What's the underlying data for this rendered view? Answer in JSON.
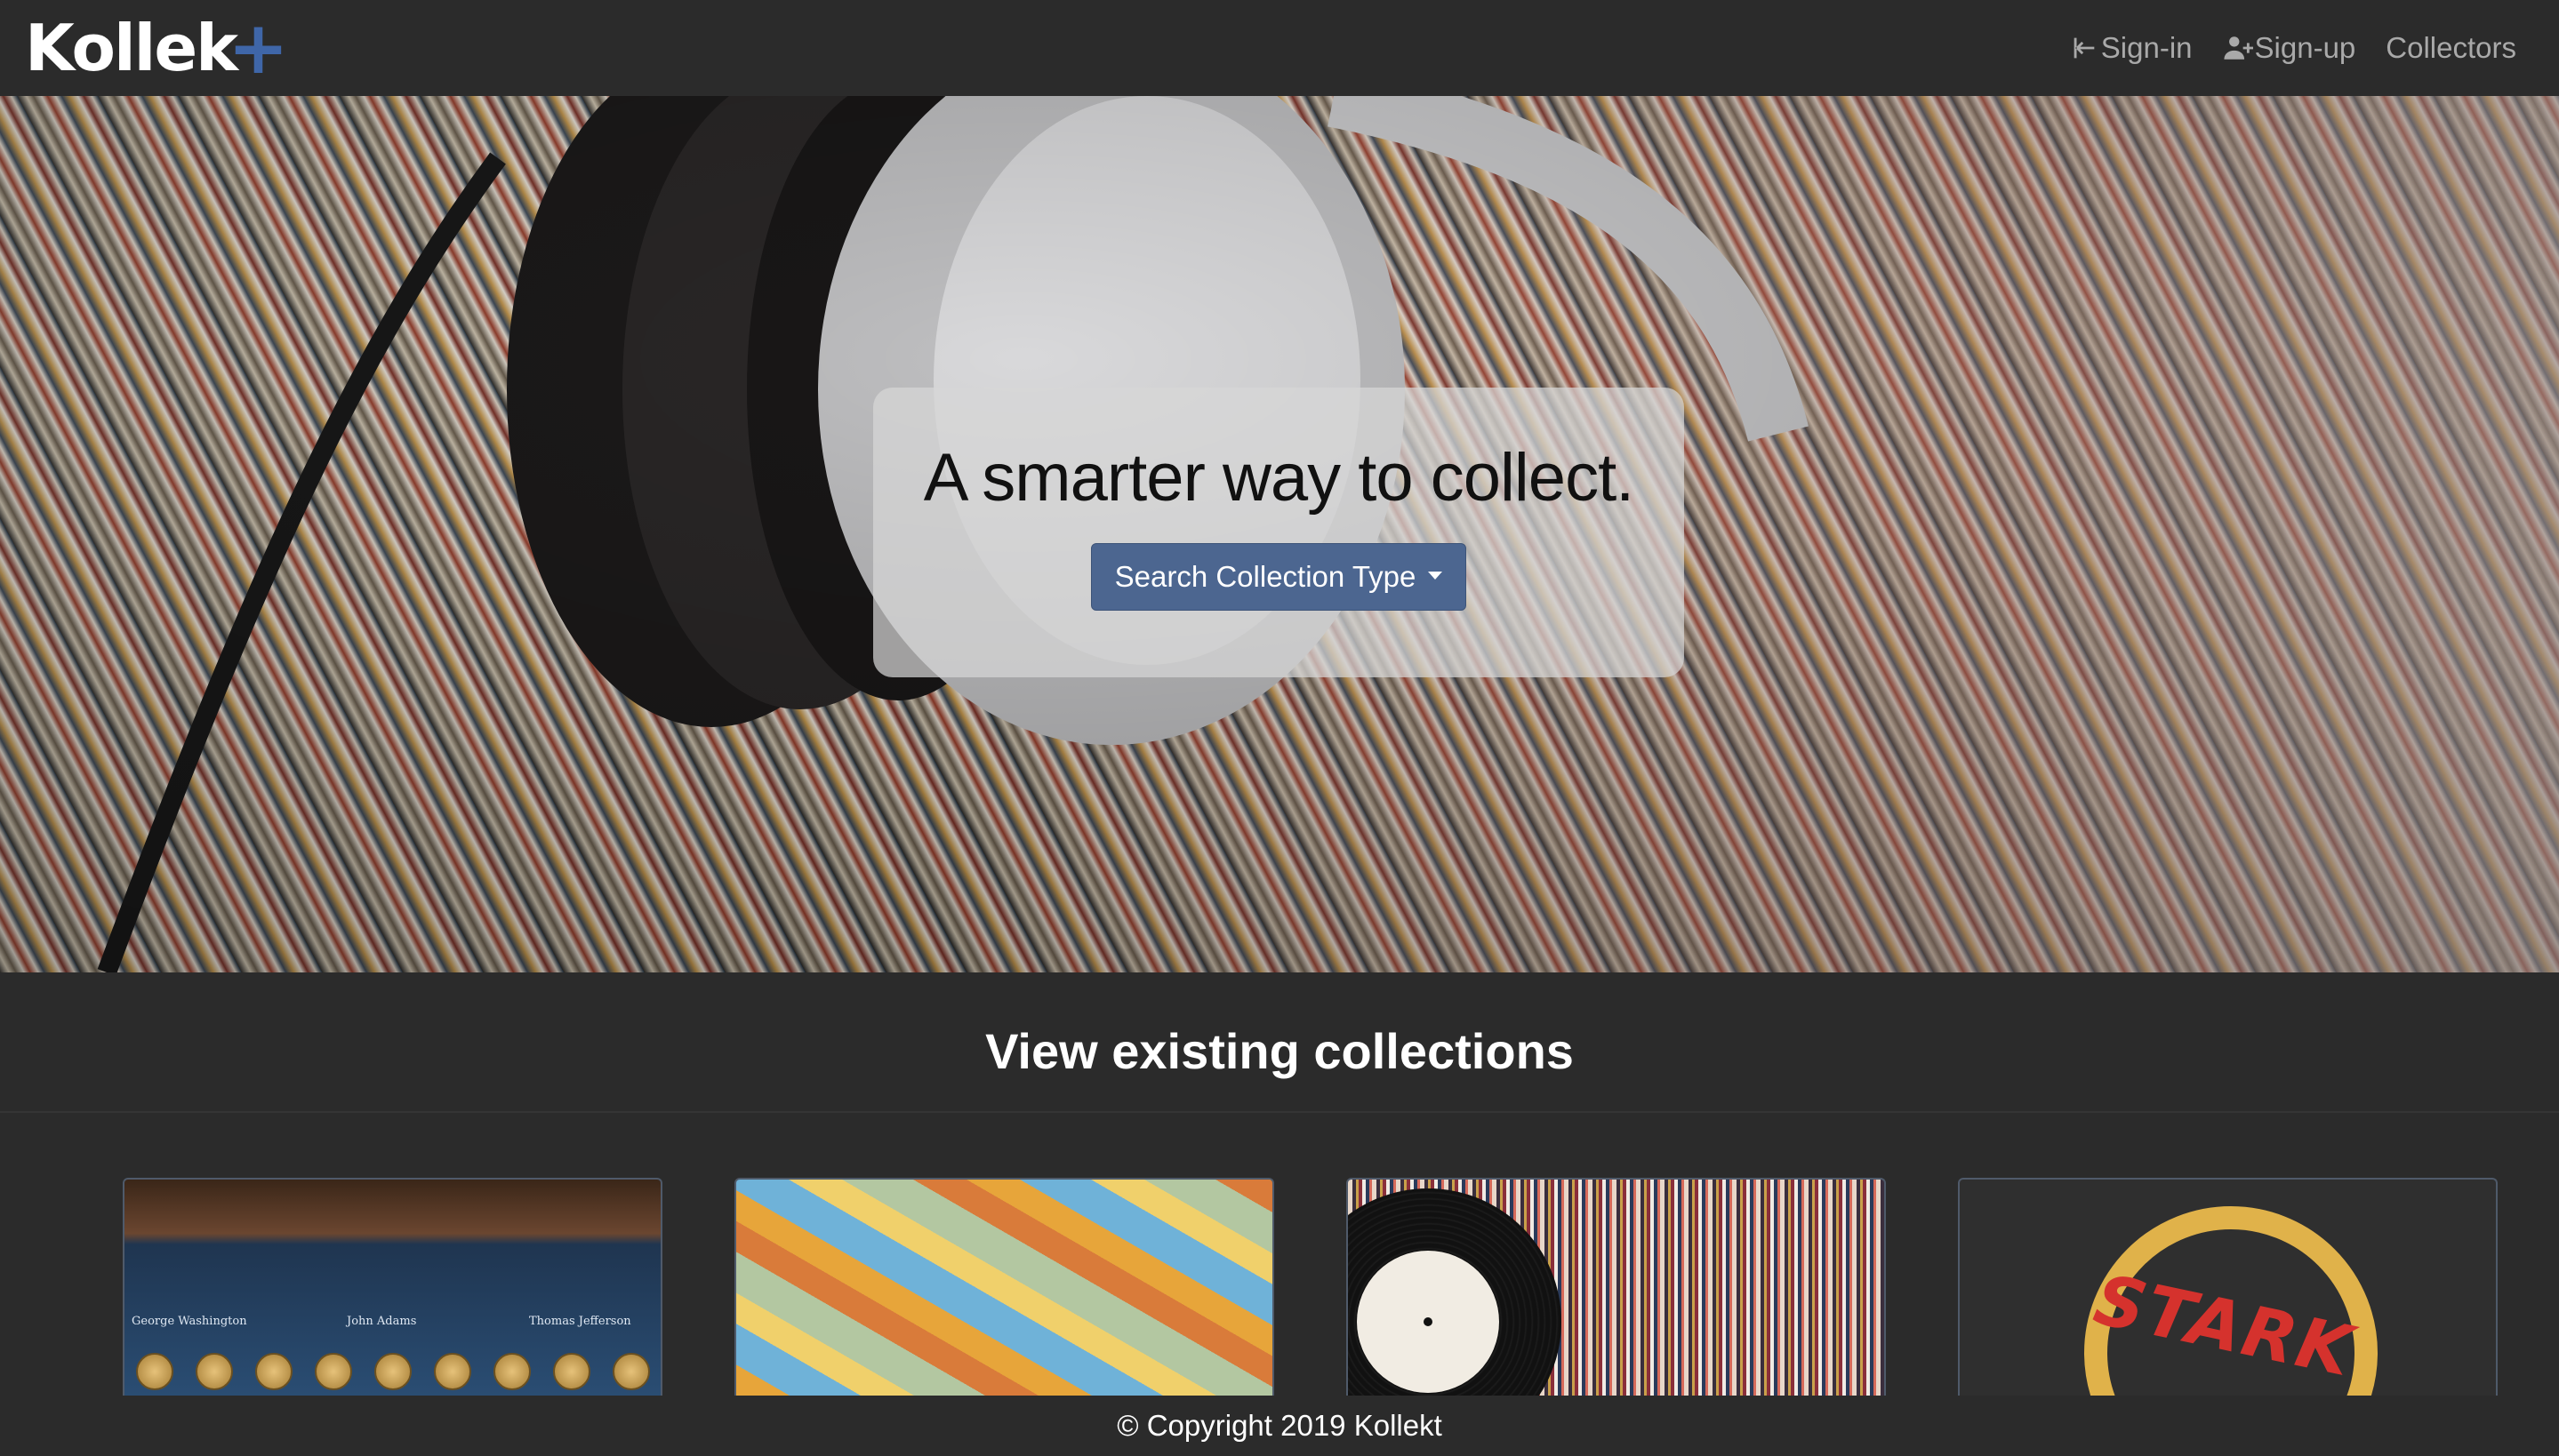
{
  "brand": {
    "name": "Kollek",
    "plus": "+"
  },
  "nav": {
    "items": [
      {
        "label": "Sign-in",
        "icon": "sign-in-icon"
      },
      {
        "label": "Sign-up",
        "icon": "user-plus-icon"
      },
      {
        "label": "Collectors",
        "icon": ""
      }
    ]
  },
  "hero": {
    "title": "A smarter way to collect.",
    "button_label": "Search Collection Type"
  },
  "section": {
    "title": "View existing collections"
  },
  "cards": [
    {
      "name": "presidential-coins",
      "labels": [
        "George Washington",
        "John Adams",
        "Thomas Jefferson"
      ]
    },
    {
      "name": "pokemon-cards"
    },
    {
      "name": "vinyl-records"
    },
    {
      "name": "stark-industries",
      "text": "STARK"
    }
  ],
  "footer": {
    "text": "© Copyright 2019 Kollekt"
  },
  "colors": {
    "navbar_bg": "#2b2b2b",
    "accent": "#3f66a8",
    "button": "#4c6690",
    "nav_text": "#a9a9a9"
  }
}
